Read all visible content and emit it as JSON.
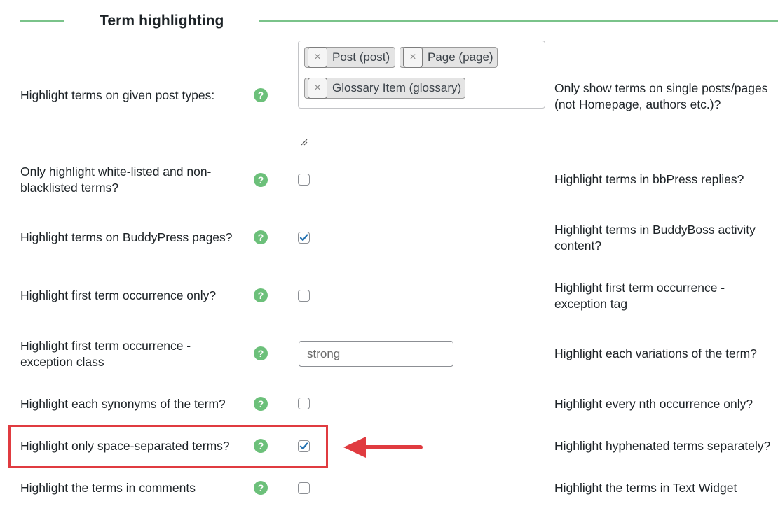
{
  "section": {
    "title": "Term highlighting",
    "accent_color": "#7ac38a"
  },
  "help_icon": {
    "glyph": "?",
    "icon": "question-icon",
    "color": "#6cc07a"
  },
  "post_types": {
    "label": "Highlight terms on given post types:",
    "chips": [
      {
        "remove": "×",
        "label": "Post (post)"
      },
      {
        "remove": "×",
        "label": "Page (page)"
      },
      {
        "remove": "×",
        "label": "Glossary Item (glossary)"
      }
    ]
  },
  "left_settings": [
    {
      "label": "Only highlight white-listed and non-blacklisted terms?",
      "checked": false
    },
    {
      "label": "Highlight terms on BuddyPress pages?",
      "checked": true
    },
    {
      "label": "Highlight first term occurrence only?",
      "checked": false
    },
    {
      "label": "Highlight first term occurrence - exception class",
      "input_value": "strong"
    },
    {
      "label": "Highlight each synonyms of the term?",
      "checked": false
    },
    {
      "label": "Highlight only space-separated terms?",
      "checked": true
    },
    {
      "label": "Highlight the terms in comments",
      "checked": false
    }
  ],
  "right_settings": [
    "Only show terms on single posts/pages (not Homepage, authors etc.)?",
    "Highlight terms in bbPress replies?",
    "Highlight terms in BuddyBoss activity content?",
    "Highlight first term occurrence - exception tag",
    "Highlight each variations of the term?",
    "Highlight every nth occurrence only?",
    "Highlight hyphenated terms separately?",
    "Highlight the terms in Text Widget"
  ],
  "annotation": {
    "color": "#e03b40"
  }
}
